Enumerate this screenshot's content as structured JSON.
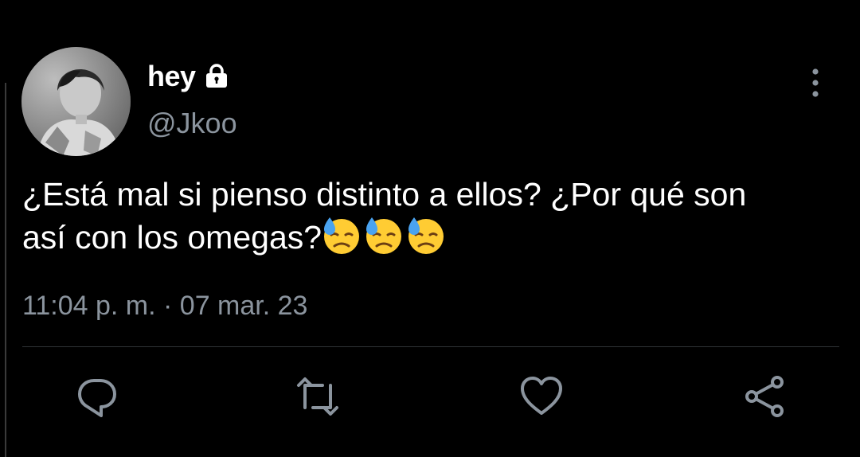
{
  "tweet": {
    "display_name": "hey",
    "handle": "@Jkoo",
    "text_line1": "¿Está mal si pienso distinto a ellos? ¿Por qué son",
    "text_line2": "así con los omegas?",
    "emoji_count": 3,
    "emoji_name": "downcast-face-with-sweat",
    "timestamp": "11:04 p. m. · 07 mar. 23"
  },
  "icons": {
    "lock": "lock-icon",
    "more": "more-vertical-icon",
    "reply": "reply-icon",
    "retweet": "retweet-icon",
    "like": "heart-icon",
    "share": "share-icon"
  },
  "colors": {
    "background": "#000000",
    "text": "#ffffff",
    "secondary": "#8b949e",
    "divider": "#2f3336"
  }
}
